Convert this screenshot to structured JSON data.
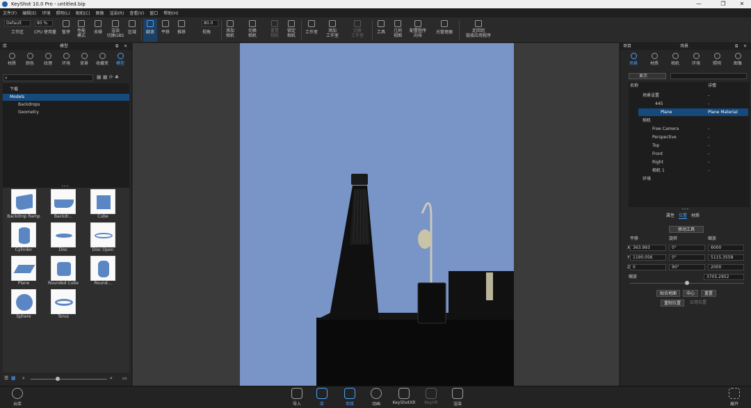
{
  "app": {
    "title": "KeyShot 10.0 Pro  -  untitled.bip"
  },
  "menu": [
    "文件(F)",
    "编辑(E)",
    "环境",
    "照明(L)",
    "相机(C)",
    "图像",
    "渲染(R)",
    "查看(V)",
    "窗口",
    "帮助(H)"
  ],
  "toolbar": {
    "workspace_value": "Default",
    "cpu_value": "80 %",
    "zoom_value": "80.0",
    "items": [
      {
        "label": "工作区"
      },
      {
        "label": "CPU 使用量"
      },
      {
        "label": "暂停"
      },
      {
        "label": "性能\n模式"
      },
      {
        "label": "去噪"
      },
      {
        "label": "渲染\n切换GBS"
      },
      {
        "label": "区域"
      },
      {
        "label": "翻滚"
      },
      {
        "label": "平移"
      },
      {
        "label": "推移"
      },
      {
        "label": "视角"
      },
      {
        "label": "添加\n相机"
      },
      {
        "label": "切换\n相机"
      },
      {
        "label": "重置\n相机"
      },
      {
        "label": "锁定\n相机"
      },
      {
        "label": "工作室"
      },
      {
        "label": "添加\n工作室"
      },
      {
        "label": "切换\n工作室"
      },
      {
        "label": "工具"
      },
      {
        "label": "几何\n视图"
      },
      {
        "label": "配置程序\n向导"
      },
      {
        "label": "光管理器"
      },
      {
        "label": "走回到\n链接应用程序"
      }
    ]
  },
  "library": {
    "panel_title": "库",
    "sub_title": "模型",
    "tabs": [
      "材质",
      "颜色",
      "纹理",
      "环境",
      "背景",
      "收藏夹",
      "模型"
    ],
    "tree": [
      {
        "label": "下载"
      },
      {
        "label": "Models"
      },
      {
        "label": "Backdrops"
      },
      {
        "label": "Geometry"
      }
    ],
    "thumbs": [
      {
        "label": "Backdrop Ramp"
      },
      {
        "label": "Backdr..."
      },
      {
        "label": "Cube"
      },
      {
        "label": "Cylinder"
      },
      {
        "label": "Disc"
      },
      {
        "label": "Disc Open"
      },
      {
        "label": "Plane"
      },
      {
        "label": "Rounded Cube"
      },
      {
        "label": "Round..."
      },
      {
        "label": "Sphere"
      },
      {
        "label": "Torus"
      }
    ]
  },
  "project": {
    "panel_title": "项目",
    "sub_title": "场景",
    "tabs": [
      "场景",
      "材质",
      "相机",
      "环境",
      "照明",
      "图像"
    ],
    "show_label": "显示",
    "col_name": "名称",
    "col_material": "详情",
    "tree": [
      {
        "name": "场景设置",
        "mat": "-"
      },
      {
        "name": "445",
        "mat": "-"
      },
      {
        "name": "Plane",
        "mat": "Plane Material"
      },
      {
        "name": "相机",
        "mat": ""
      },
      {
        "name": "Free Camera",
        "mat": "-"
      },
      {
        "name": "Perspective",
        "mat": "-"
      },
      {
        "name": "Top",
        "mat": "-"
      },
      {
        "name": "Front",
        "mat": "-"
      },
      {
        "name": "Right",
        "mat": "-"
      },
      {
        "name": "相机 1",
        "mat": "-"
      },
      {
        "name": "环境",
        "mat": ""
      }
    ],
    "prop_tabs": [
      "属性",
      "位置",
      "材质"
    ],
    "move_tool": "移动工具",
    "headers": {
      "translate": "平移",
      "rotate": "旋转",
      "scale": "缩放"
    },
    "x": {
      "t": "363.993",
      "r": "0°",
      "s": "6000"
    },
    "y": {
      "t": "1190.056",
      "r": "0°",
      "s": "5115.3558"
    },
    "z": {
      "t": "0",
      "r": "90°",
      "s": "2000"
    },
    "uniform_label": "缩放",
    "uniform_value": "3705.2952",
    "btn_snap": "贴合地面",
    "btn_center": "中心",
    "btn_reset": "重置",
    "btn_reset_pos": "重制位置",
    "btn_apply": "应用位置"
  },
  "bottom": {
    "cloud": "云库",
    "items": [
      "导入",
      "库",
      "项目",
      "动画",
      "KeyShotXR",
      "KeyVR",
      "渲染"
    ],
    "expand": "展开"
  },
  "colors": {
    "accent": "#4aa3ff",
    "selection": "#164a7d",
    "render_bg": "#7a96c8"
  }
}
